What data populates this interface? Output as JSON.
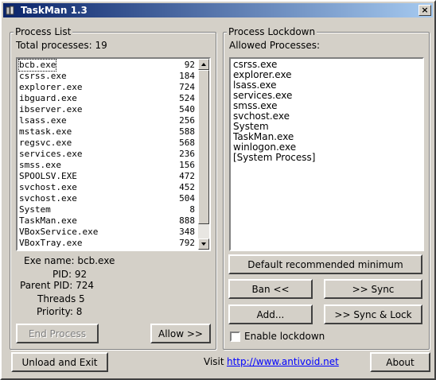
{
  "window": {
    "title": "TaskMan 1.3",
    "close_glyph": "×"
  },
  "process_list": {
    "group_label": "Process List",
    "total_label": "Total processes: 19",
    "processes": [
      {
        "name": "bcb.exe",
        "pid": "92"
      },
      {
        "name": "csrss.exe",
        "pid": "184"
      },
      {
        "name": "explorer.exe",
        "pid": "724"
      },
      {
        "name": "ibguard.exe",
        "pid": "524"
      },
      {
        "name": "ibserver.exe",
        "pid": "540"
      },
      {
        "name": "lsass.exe",
        "pid": "256"
      },
      {
        "name": "mstask.exe",
        "pid": "588"
      },
      {
        "name": "regsvc.exe",
        "pid": "568"
      },
      {
        "name": "services.exe",
        "pid": "236"
      },
      {
        "name": "smss.exe",
        "pid": "156"
      },
      {
        "name": "SPOOLSV.EXE",
        "pid": "472"
      },
      {
        "name": "svchost.exe",
        "pid": "452"
      },
      {
        "name": "svchost.exe",
        "pid": "504"
      },
      {
        "name": "System",
        "pid": "8"
      },
      {
        "name": "TaskMan.exe",
        "pid": "888"
      },
      {
        "name": "VBoxService.exe",
        "pid": "348"
      },
      {
        "name": "VBoxTray.exe",
        "pid": "792"
      }
    ],
    "details": {
      "exe_name": "Exe name: bcb.exe",
      "pid": "PID: 92",
      "parent_pid": "Parent PID: 724",
      "threads": "Threads 5",
      "priority": "Priority: 8"
    },
    "end_process_label": "End Process",
    "allow_label": "Allow >>"
  },
  "lockdown": {
    "group_label": "Process Lockdown",
    "allowed_label": "Allowed Processes:",
    "allowed": [
      "csrss.exe",
      "explorer.exe",
      "lsass.exe",
      "services.exe",
      "smss.exe",
      "svchost.exe",
      "System",
      "TaskMan.exe",
      "winlogon.exe",
      "[System Process]"
    ],
    "default_min_label": "Default recommended minimum",
    "ban_label": "Ban <<",
    "sync_label": ">> Sync",
    "add_label": "Add...",
    "sync_lock_label": ">> Sync & Lock",
    "enable_lockdown_label": "Enable lockdown"
  },
  "footer": {
    "unload_label": "Unload and Exit",
    "visit_label": "Visit",
    "url": "http://www.antivoid.net",
    "about_label": "About"
  }
}
